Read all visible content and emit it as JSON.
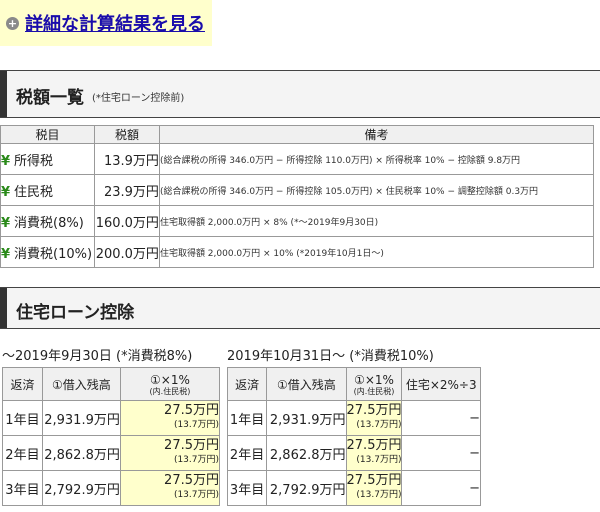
{
  "detail_link": {
    "icon": "plus-circle-icon",
    "label": "詳細な計算結果を見る"
  },
  "tax_section": {
    "title": "税額一覧",
    "note": "(*住宅ローン控除前)"
  },
  "tax_table": {
    "headers": [
      "税目",
      "税額",
      "備考"
    ],
    "rows": [
      {
        "icon": "yen-icon",
        "name": "所得税",
        "amount": "13.9万円",
        "note": "(総合課税の所得 346.0万円 − 所得控除 110.0万円) × 所得税率 10% − 控除額 9.8万円"
      },
      {
        "icon": "yen-icon",
        "name": "住民税",
        "amount": "23.9万円",
        "note": "(総合課税の所得 346.0万円 − 所得控除 105.0万円) × 住民税率 10% − 調整控除額 0.3万円"
      },
      {
        "icon": "yen-icon",
        "name": "消費税(8%)",
        "amount": "160.0万円",
        "note": "住宅取得額 2,000.0万円 × 8% (*〜2019年9月30日)"
      },
      {
        "icon": "yen-icon",
        "name": "消費税(10%)",
        "amount": "200.0万円",
        "note": "住宅取得額 2,000.0万円 × 10% (*2019年10月1日〜)"
      }
    ]
  },
  "loan_section": {
    "title": "住宅ローン控除"
  },
  "loan_tables": [
    {
      "period": "〜2019年9月30日 (*消費税8%)",
      "headers": {
        "year": "返済",
        "balance": "①借入残高",
        "deduct": "①×1%",
        "deduct_sub": "(内.住民税)"
      },
      "rows": [
        {
          "year": "1年目",
          "balance": "2,931.9万円",
          "deduct": "27.5万円",
          "deduct_sub": "(13.7万円)"
        },
        {
          "year": "2年目",
          "balance": "2,862.8万円",
          "deduct": "27.5万円",
          "deduct_sub": "(13.7万円)"
        },
        {
          "year": "3年目",
          "balance": "2,792.9万円",
          "deduct": "27.5万円",
          "deduct_sub": "(13.7万円)"
        }
      ]
    },
    {
      "period": "2019年10月31日〜 (*消費税10%)",
      "headers": {
        "year": "返済",
        "balance": "①借入残高",
        "deduct": "①×1%",
        "deduct_sub": "(内.住民税)",
        "extra": "住宅×2%÷3"
      },
      "rows": [
        {
          "year": "1年目",
          "balance": "2,931.9万円",
          "deduct": "27.5万円",
          "deduct_sub": "(13.7万円)",
          "extra": "−"
        },
        {
          "year": "2年目",
          "balance": "2,862.8万円",
          "deduct": "27.5万円",
          "deduct_sub": "(13.7万円)",
          "extra": "−"
        },
        {
          "year": "3年目",
          "balance": "2,792.9万円",
          "deduct": "27.5万円",
          "deduct_sub": "(13.7万円)",
          "extra": "−"
        }
      ]
    }
  ]
}
